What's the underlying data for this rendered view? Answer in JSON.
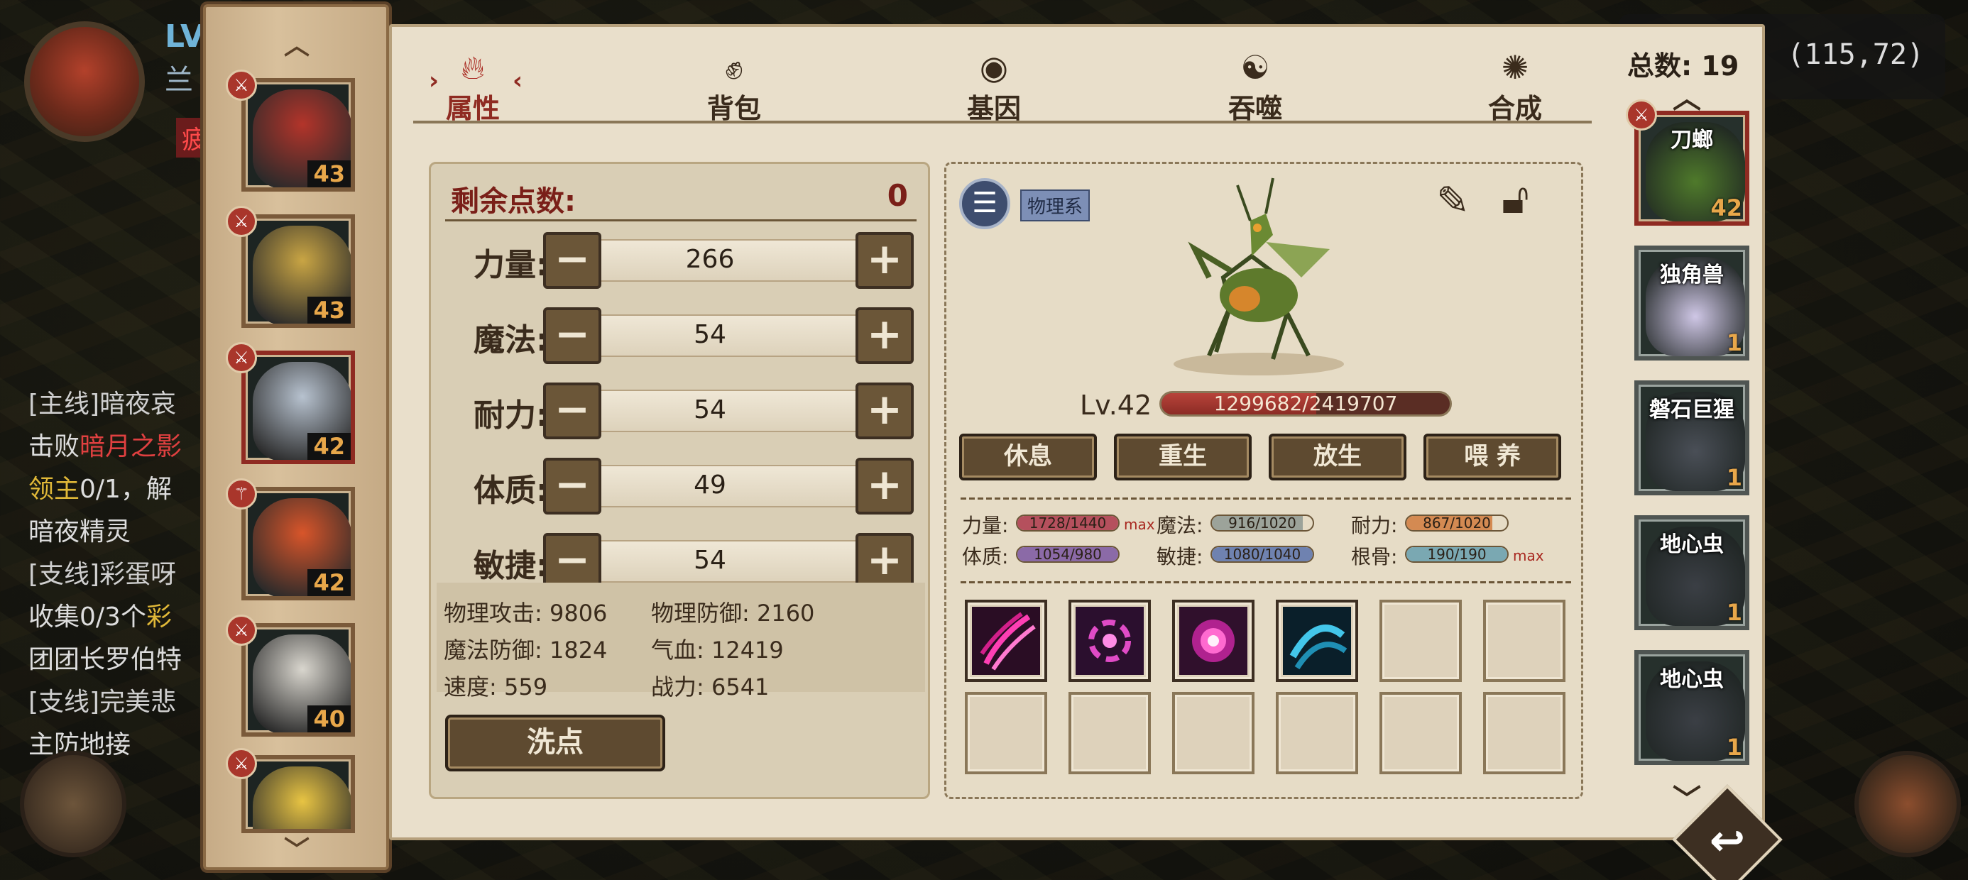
{
  "player": {
    "level_prefix": "LV",
    "name_fragment": "兰",
    "status_tag": "疲"
  },
  "quests": [
    {
      "text": "[主线]暗夜哀"
    },
    {
      "prefix": "击败",
      "target": "暗月之影"
    },
    {
      "target": "领主",
      "progress": "0/1，解"
    },
    {
      "text": "暗夜精灵"
    },
    {
      "text": "[支线]彩蛋呀"
    },
    {
      "prefix": "收集0/3个",
      "target": "彩"
    },
    {
      "text": "团团长罗伯特"
    },
    {
      "text": "[支线]完美悲"
    },
    {
      "text": "主防地接"
    }
  ],
  "coordinates": "(115,72)",
  "tabs": [
    {
      "label": "属性",
      "icon": "flame-icon",
      "active": true
    },
    {
      "label": "背包",
      "icon": "backpack-icon",
      "active": false
    },
    {
      "label": "基因",
      "icon": "gene-icon",
      "active": false
    },
    {
      "label": "吞噬",
      "icon": "devour-icon",
      "active": false
    },
    {
      "label": "合成",
      "icon": "synthesis-icon",
      "active": false
    }
  ],
  "pet_list": [
    {
      "level": "43",
      "color": "#b3342a",
      "badge": "sword-icon",
      "selected": false
    },
    {
      "level": "43",
      "color": "#c9a544",
      "badge": "sword-icon",
      "selected": false
    },
    {
      "level": "42",
      "color": "#b7c2cf",
      "badge": "sword-icon",
      "selected": true
    },
    {
      "level": "42",
      "color": "#d8552a",
      "badge": "staff-icon",
      "selected": false
    },
    {
      "level": "40",
      "color": "#d9d6ce",
      "badge": "sword-icon",
      "selected": false
    },
    {
      "level": "",
      "color": "#e8c443",
      "badge": "sword-icon",
      "selected": false
    }
  ],
  "attributes": {
    "remaining_label": "剩余点数:",
    "remaining_value": "0",
    "stats": [
      {
        "label": "力量:",
        "value": "266"
      },
      {
        "label": "魔法:",
        "value": "54"
      },
      {
        "label": "耐力:",
        "value": "54"
      },
      {
        "label": "体质:",
        "value": "49"
      },
      {
        "label": "敏捷:",
        "value": "54"
      }
    ],
    "derived": [
      {
        "label": "物理攻击:",
        "value": "9806"
      },
      {
        "label": "物理防御:",
        "value": "2160"
      },
      {
        "label": "魔法防御:",
        "value": "1824"
      },
      {
        "label": "气血:",
        "value": "12419"
      },
      {
        "label": "速度:",
        "value": "559"
      },
      {
        "label": "战力:",
        "value": "6541"
      }
    ],
    "wash_label": "洗点"
  },
  "pet_detail": {
    "type_tag": "物理系",
    "level": "Lv.42",
    "hp_text": "1299682/2419707",
    "hp_ratio": 0.537,
    "actions": [
      "休息",
      "重生",
      "放生",
      "喂 养"
    ],
    "caps": [
      {
        "label": "力量:",
        "text": "1728/1440",
        "ratio": 1.0,
        "color": "#b5505d",
        "max": "max"
      },
      {
        "label": "魔法:",
        "text": "916/1020",
        "ratio": 0.9,
        "color": "#9ca39a",
        "max": ""
      },
      {
        "label": "耐力:",
        "text": "867/1020",
        "ratio": 0.85,
        "color": "#d48a52",
        "max": ""
      },
      {
        "label": "体质:",
        "text": "1054/980",
        "ratio": 1.0,
        "color": "#8b6aa7",
        "max": ""
      },
      {
        "label": "敏捷:",
        "text": "1080/1040",
        "ratio": 1.0,
        "color": "#6f82b0",
        "max": ""
      },
      {
        "label": "根骨:",
        "text": "190/190",
        "ratio": 1.0,
        "color": "#7aa8b2",
        "max": "max"
      }
    ],
    "skills": [
      {
        "icon": "claw-slash-icon",
        "filled": true
      },
      {
        "icon": "vortex-burst-icon",
        "filled": true
      },
      {
        "icon": "radiant-orb-icon",
        "filled": true
      },
      {
        "icon": "ice-wave-icon",
        "filled": true
      },
      {
        "icon": "",
        "filled": false
      },
      {
        "icon": "",
        "filled": false
      },
      {
        "icon": "",
        "filled": false
      },
      {
        "icon": "",
        "filled": false
      },
      {
        "icon": "",
        "filled": false
      },
      {
        "icon": "",
        "filled": false
      },
      {
        "icon": "",
        "filled": false
      },
      {
        "icon": "",
        "filled": false
      }
    ]
  },
  "team": {
    "total_label": "总数: 19",
    "members": [
      {
        "name": "刀螂",
        "level": "42",
        "color": "#4f7a2b",
        "selected": true
      },
      {
        "name": "独角兽",
        "level": "1",
        "color": "#cfc7e6",
        "selected": false
      },
      {
        "name": "磐石巨猩",
        "level": "1",
        "color": "#4a4f57",
        "selected": false
      },
      {
        "name": "地心虫",
        "level": "1",
        "color": "#3b3f45",
        "selected": false
      },
      {
        "name": "地心虫",
        "level": "1",
        "color": "#3b3f45",
        "selected": false
      }
    ]
  }
}
